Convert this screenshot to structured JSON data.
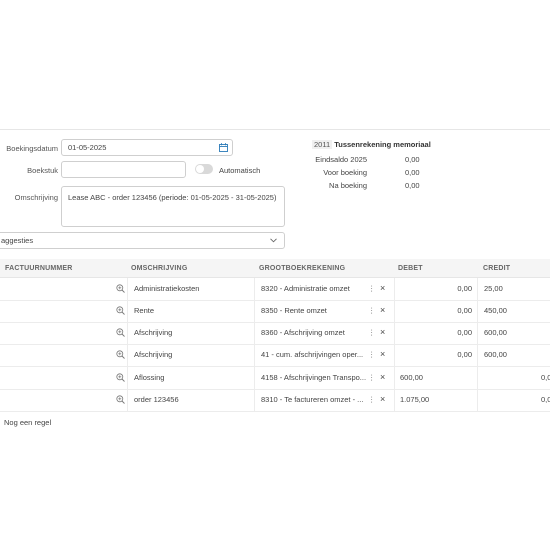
{
  "form": {
    "boekingsdatum_label": "Boekingsdatum",
    "boekingsdatum_value": "01-05-2025",
    "boekstuk_label": "Boekstuk",
    "boekstuk_value": "",
    "automatisch_label": "Automatisch",
    "omschrijving_label": "Omschrijving",
    "omschrijving_value": "Lease ABC - order 123456  (periode: 01-05-2025 - 31-05-2025)",
    "suggesties_label": "aggesties"
  },
  "summary": {
    "code": "2011",
    "title": "Tussenrekening memoriaal",
    "eindsaldo_label": "Eindsaldo 2025",
    "eindsaldo_value": "0,00",
    "voor_label": "Voor boeking",
    "voor_value": "0,00",
    "na_label": "Na boeking",
    "na_value": "0,00"
  },
  "table": {
    "headers": {
      "factuurnummer": "FACTUURNUMMER",
      "omschrijving": "OMSCHRIJVING",
      "grootboekrekening": "GROOTBOEKREKENING",
      "debet": "DEBET",
      "credit": "CREDIT"
    },
    "rows": [
      {
        "omschrijving": "Administratiekosten",
        "grootboek": "8320 - Administratie omzet",
        "debet": "0,00",
        "credit": "25,00",
        "extra": ""
      },
      {
        "omschrijving": "Rente",
        "grootboek": "8350 - Rente omzet",
        "debet": "0,00",
        "credit": "450,00",
        "extra": ""
      },
      {
        "omschrijving": "Afschrijving",
        "grootboek": "8360 - Afschrijving omzet",
        "debet": "0,00",
        "credit": "600,00",
        "extra": ""
      },
      {
        "omschrijving": "Afschrijving",
        "grootboek": "41 - cum. afschrijvingen oper...",
        "debet": "0,00",
        "credit": "600,00",
        "extra": ""
      },
      {
        "omschrijving": "Aflossing",
        "grootboek": "4158 - Afschrijvingen Transpo...",
        "debet": "600,00",
        "credit": "",
        "extra": "0,0"
      },
      {
        "omschrijving": "order 123456",
        "grootboek": "8310 - Te factureren omzet - ...",
        "debet": "1.075,00",
        "credit": "",
        "extra": "0,0"
      }
    ],
    "add_row_label": "Nog een regel"
  },
  "colors": {
    "border": "#cfcfcf",
    "header_bg": "#f5f5f5",
    "text": "#333333"
  }
}
